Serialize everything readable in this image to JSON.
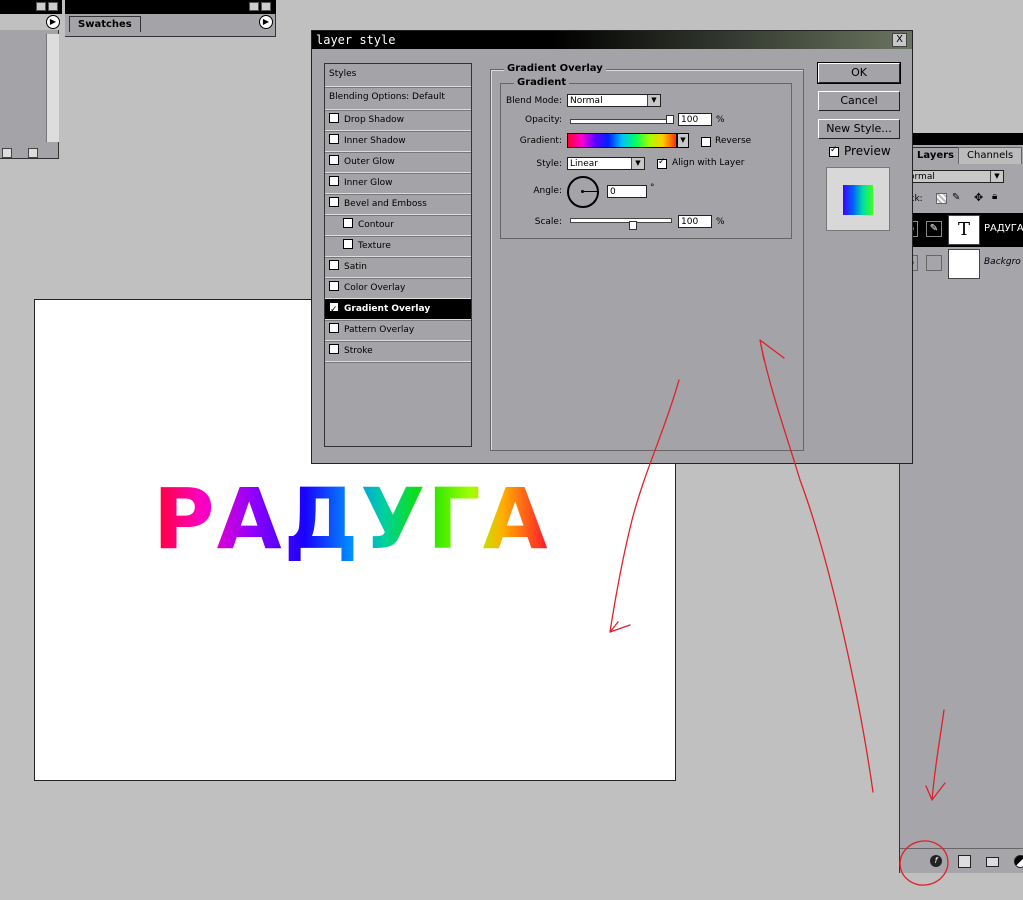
{
  "palettes": {
    "swatches_title": "Swatches"
  },
  "canvas": {
    "text": "РАДУГА"
  },
  "layers_panel": {
    "tabs": [
      "Layers",
      "Channels"
    ],
    "blend_mode": "ormal",
    "lock_label": "ock:",
    "layers": [
      {
        "thumb": "T",
        "name": "РАДУГА"
      },
      {
        "thumb": "",
        "name": "Backgro"
      }
    ]
  },
  "dialog": {
    "title": "layer style",
    "close": "X",
    "style_list": [
      {
        "label": "Styles",
        "type": "header"
      },
      {
        "label": "Blending Options: Default",
        "type": "header"
      },
      {
        "label": "Drop Shadow",
        "checked": false
      },
      {
        "label": "Inner Shadow",
        "checked": false
      },
      {
        "label": "Outer Glow",
        "checked": false
      },
      {
        "label": "Inner Glow",
        "checked": false
      },
      {
        "label": "Bevel and Emboss",
        "checked": false
      },
      {
        "label": "Contour",
        "checked": false,
        "indent": true
      },
      {
        "label": "Texture",
        "checked": false,
        "indent": true
      },
      {
        "label": "Satin",
        "checked": false
      },
      {
        "label": "Color Overlay",
        "checked": false
      },
      {
        "label": "Gradient Overlay",
        "checked": true,
        "selected": true
      },
      {
        "label": "Pattern Overlay",
        "checked": false
      },
      {
        "label": "Stroke",
        "checked": false
      }
    ],
    "section_title": "Gradient Overlay",
    "group_title": "Gradient",
    "blend_mode_label": "Blend Mode:",
    "blend_mode_value": "Normal",
    "opacity_label": "Opacity:",
    "opacity_value": "100",
    "opacity_unit": "%",
    "gradient_label": "Gradient:",
    "reverse_label": "Reverse",
    "style_label": "Style:",
    "style_value": "Linear",
    "align_label": "Align with Layer",
    "angle_label": "Angle:",
    "angle_value": "0",
    "angle_unit": "°",
    "scale_label": "Scale:",
    "scale_value": "100",
    "scale_unit": "%",
    "buttons": {
      "ok": "OK",
      "cancel": "Cancel",
      "new_style": "New Style..."
    },
    "preview_label": "Preview"
  },
  "colors": {
    "annotation": "#e0202a",
    "panel": "#a4a4a8"
  }
}
